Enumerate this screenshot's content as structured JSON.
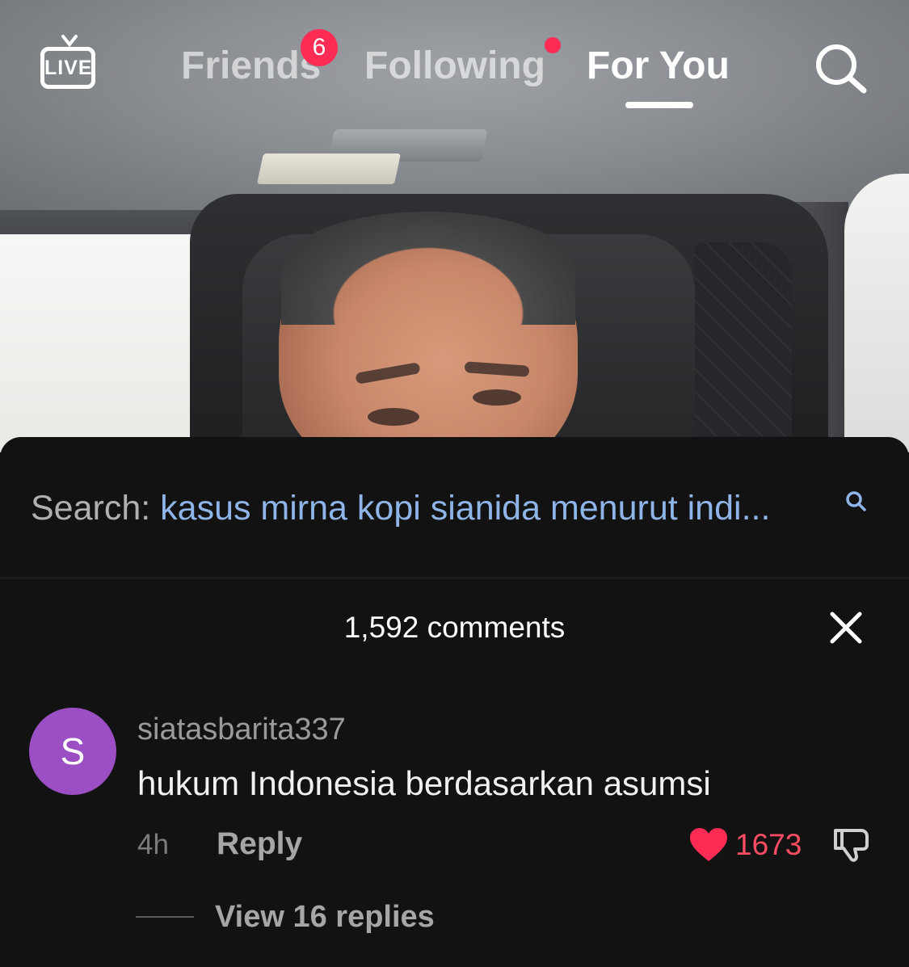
{
  "nav": {
    "live_label": "LIVE",
    "tabs": [
      {
        "label": "Friends",
        "badge": "6"
      },
      {
        "label": "Following"
      },
      {
        "label": "For You",
        "active": true
      }
    ]
  },
  "search": {
    "label": "Search:",
    "query": "kasus mirna kopi sianida menurut indi..."
  },
  "comments": {
    "count_label": "1,592 comments",
    "items": [
      {
        "avatar_initial": "S",
        "avatar_color": "#9c4fc4",
        "username": "siatasbarita337",
        "text": "hukum Indonesia berdasarkan asumsi",
        "time": "4h",
        "reply_label": "Reply",
        "likes": "1673",
        "view_replies": "View 16 replies"
      }
    ]
  },
  "colors": {
    "accent": "#fe2c55",
    "search_query": "#8fb4e8",
    "sheet_bg": "#121212"
  },
  "icons": [
    "tv-live-icon",
    "search-icon",
    "small-search-icon",
    "close-icon",
    "heart-icon",
    "thumbs-down-icon"
  ]
}
